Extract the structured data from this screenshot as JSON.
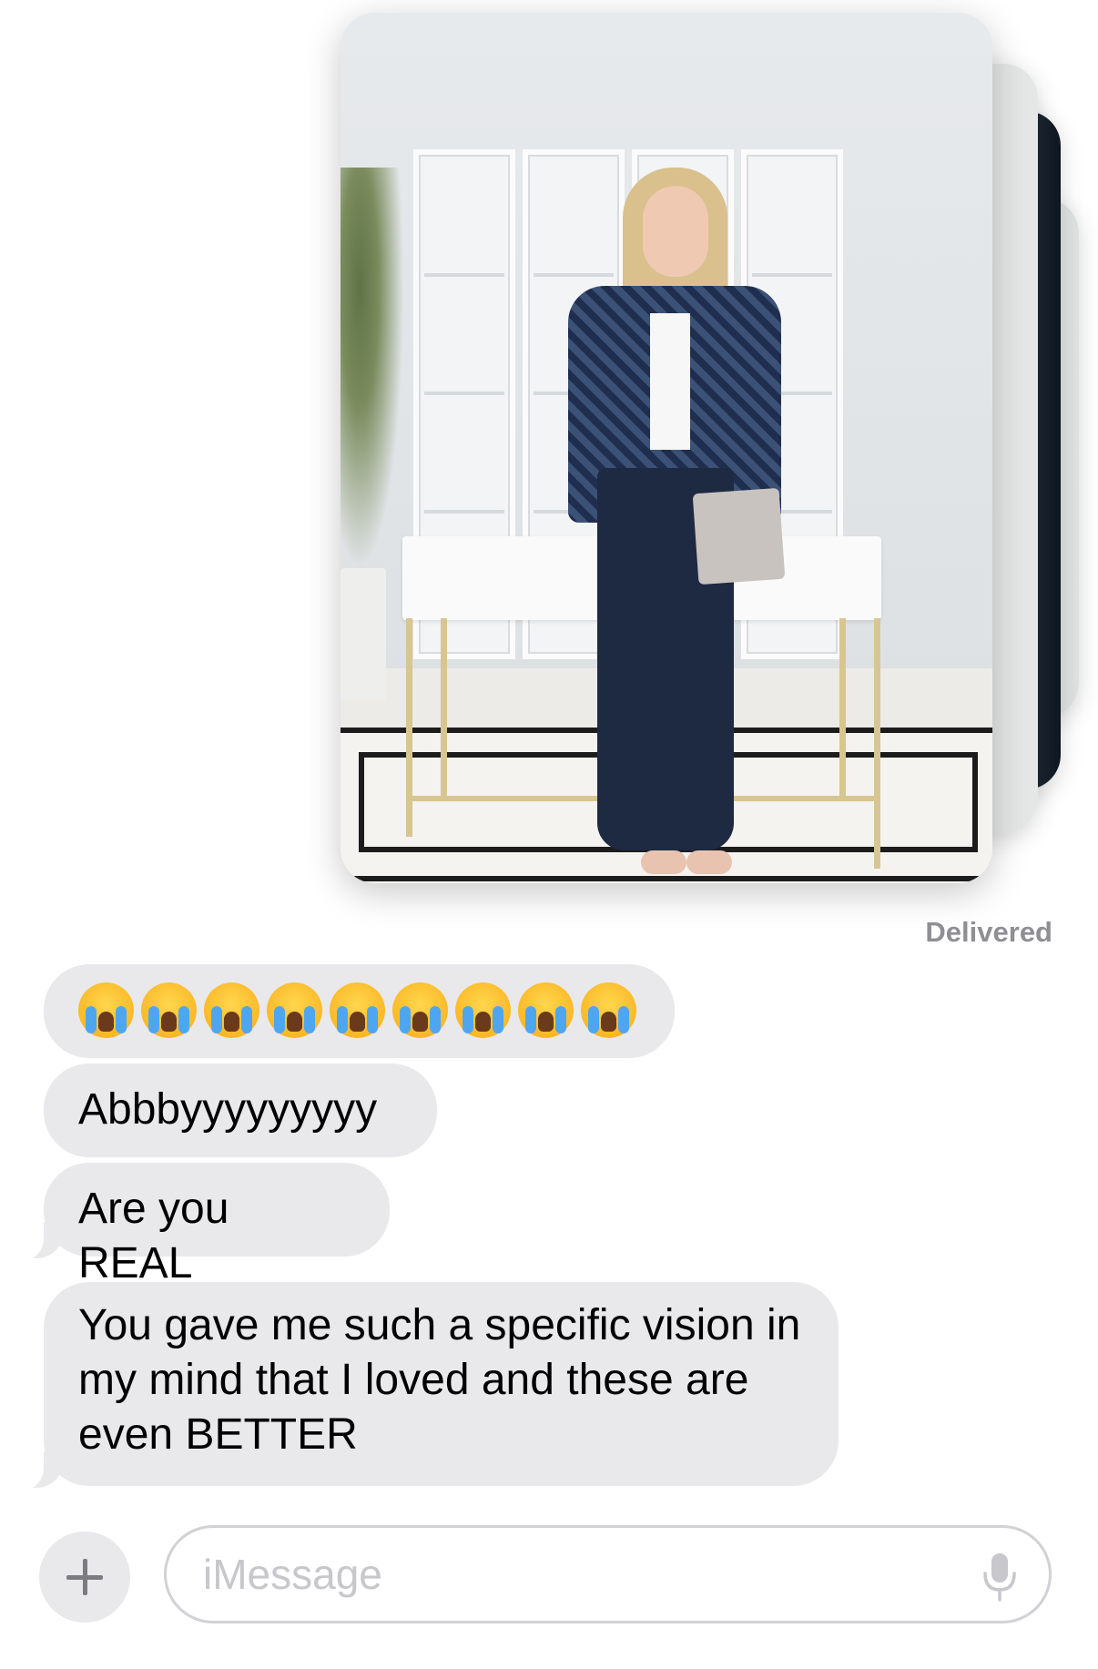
{
  "conversation": {
    "status_text": "Delivered",
    "photo_stack": {
      "count_visible": 4,
      "alt": "portrait photo"
    },
    "messages": [
      {
        "type": "emoji",
        "text": "😭😭😭😭😭😭😭😭😭",
        "emoji_count": 9
      },
      {
        "type": "text",
        "text": "Abbbyyyyyyyyy"
      },
      {
        "type": "text",
        "text": "Are you REAL"
      },
      {
        "type": "text",
        "text": "You gave me such a specific vision in my mind that I loved and these are even BETTER"
      }
    ]
  },
  "composer": {
    "placeholder": "iMessage",
    "plus_icon": "plus-icon",
    "mic_icon": "microphone-icon"
  },
  "colors": {
    "incoming_bubble": "#e9e9eb",
    "status_gray": "#8e8e93",
    "placeholder_gray": "#c7c7cc"
  }
}
